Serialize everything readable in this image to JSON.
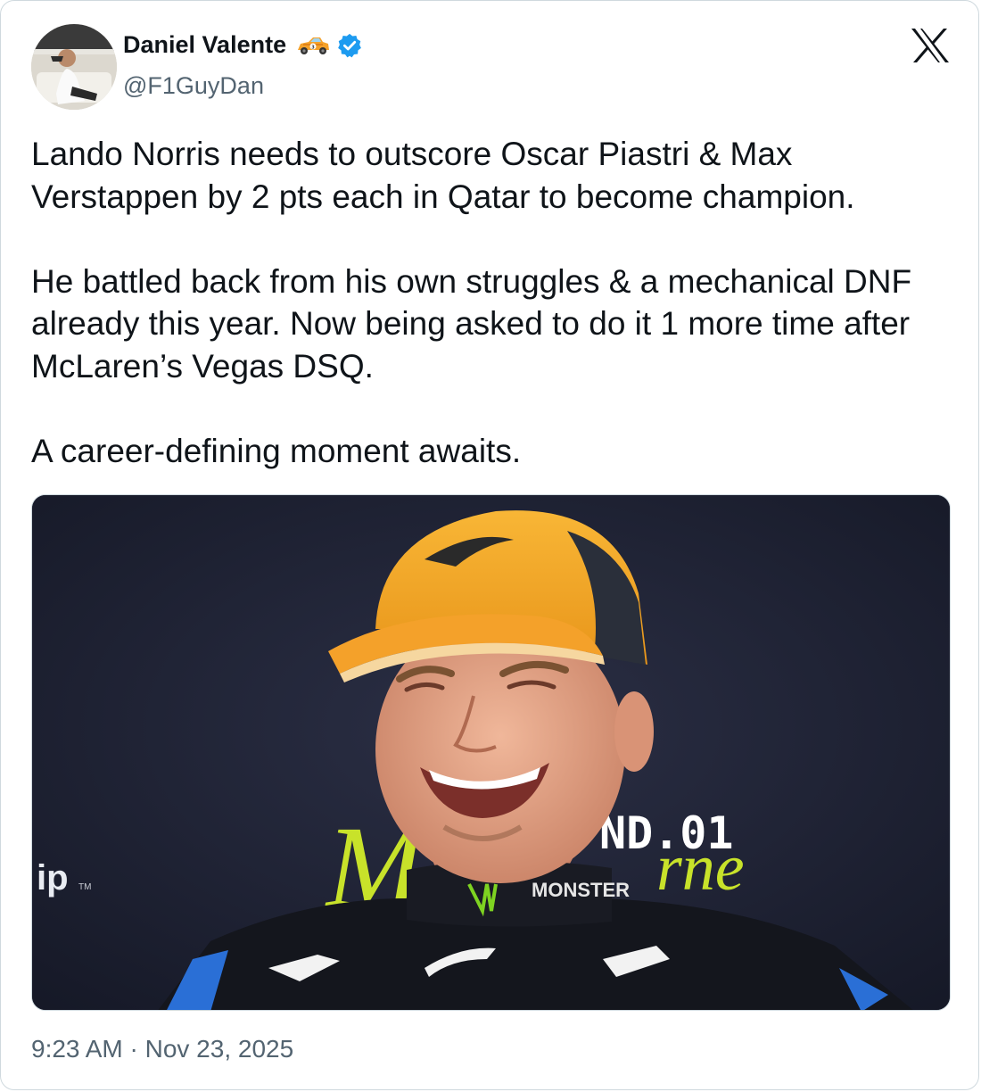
{
  "author": {
    "display_name": "Daniel Valente",
    "handle": "@F1GuyDan",
    "name_emoji": "race-car-emoji",
    "verified_badge": "verified-check-icon"
  },
  "brand_icon": "x-logo-icon",
  "tweet": {
    "paragraphs": [
      "Lando Norris needs to outscore Oscar Piastri & Max Verstappen by 2 pts each in Qatar to become champion.",
      "He battled back from his own struggles & a mechanical DNF already this year. Now being asked to do it 1 more time after McLaren’s Vegas DSQ.",
      "A career-defining moment awaits."
    ]
  },
  "media": {
    "backdrop_text_1": "ND.01",
    "backdrop_text_2": "M",
    "backdrop_text_3": "rne",
    "backdrop_text_4": "ip",
    "backdrop_text_4_suffix": "TM",
    "suit_sponsor": "MONSTER"
  },
  "timestamp": "9:23 AM · Nov 23, 2025",
  "colors": {
    "verified_blue": "#1d9bf0",
    "text_primary": "#0f1419",
    "text_secondary": "#536471",
    "cap_papaya": "#f6a623",
    "backdrop_navy": "#1c1f2e",
    "backdrop_lime": "#c8e22a"
  }
}
